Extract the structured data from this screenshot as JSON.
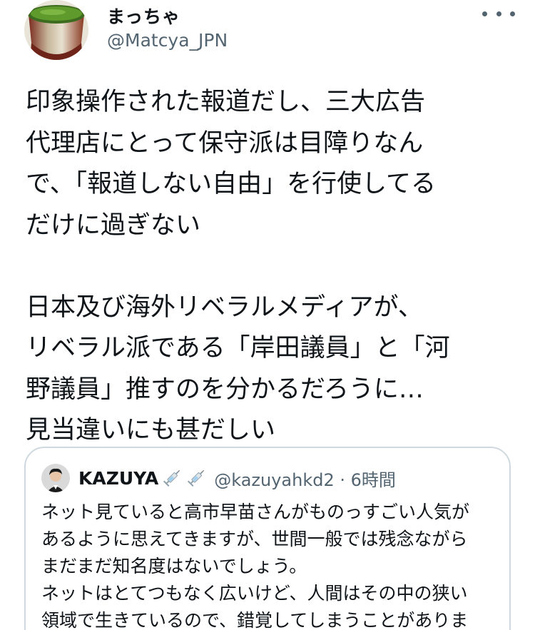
{
  "author": {
    "display_name": "まっちゃ",
    "handle": "@Matcya_JPN",
    "avatar_icon": "matcha-cup-avatar"
  },
  "more_icon": "more-horizontal-icon",
  "tweet": {
    "lines": [
      "印象操作された報道だし、三大広告",
      "代理店にとって保守派は目障りなん",
      "で、「報道しない自由」を行使してる",
      "だけに過ぎない",
      "",
      "日本及び海外リベラルメディアが、",
      "リベラル派である「岸田議員」と「河",
      "野議員」推すのを分かるだろうに…",
      "見当違いにも甚だしい"
    ]
  },
  "quote": {
    "display_name": "KAZUYA",
    "emoji_icon": "syringe-icon",
    "handle_time": "@kazuyahkd2 · 6時間",
    "lines": [
      "ネット見ていると高市早苗さんがものっすごい人気が",
      "あるように思えてきますが、世間一般では残念ながら",
      "まだまだ知名度はないでしょう。",
      "ネットはとてつもなく広いけど、人間はその中の狭い",
      "領域で生きているので、錯覚してしまうことがありま"
    ]
  },
  "colors": {
    "text": "#0f1419",
    "secondary": "#536471",
    "border": "#cfd9de"
  }
}
